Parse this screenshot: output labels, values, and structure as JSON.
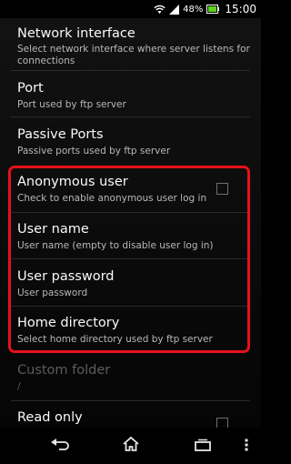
{
  "status_bar": {
    "battery_percent": "48%",
    "time": "15:00",
    "icons": [
      "wifi-icon",
      "signal-icon",
      "battery-icon"
    ]
  },
  "preferences": {
    "network_interface": {
      "title": "Network interface",
      "summary": "Select network interface where server listens for connections"
    },
    "port": {
      "title": "Port",
      "summary": "Port used by ftp server"
    },
    "passive_ports": {
      "title": "Passive Ports",
      "summary": "Passive ports used by ftp server"
    },
    "anonymous_user": {
      "title": "Anonymous user",
      "summary": "Check to enable anonymous user log in",
      "checked": false
    },
    "user_name": {
      "title": "User name",
      "summary": "User name (empty to disable user log in)"
    },
    "user_password": {
      "title": "User password",
      "summary": "User password"
    },
    "home_directory": {
      "title": "Home directory",
      "summary": "Select home directory used by ftp server"
    },
    "custom_folder": {
      "title": "Custom folder",
      "summary": "/",
      "enabled": false
    },
    "read_only": {
      "title": "Read only",
      "checked": false
    }
  },
  "highlight_color": "#e8101a",
  "nav_bar": {
    "icons": [
      "back-icon",
      "home-icon",
      "recent-apps-icon",
      "overflow-menu-icon"
    ]
  }
}
